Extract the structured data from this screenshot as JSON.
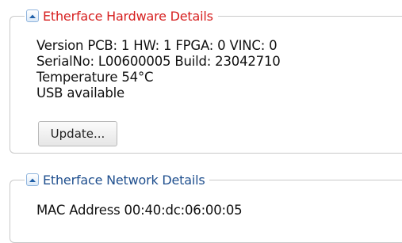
{
  "hardware": {
    "title": "Etherface Hardware Details",
    "lines": [
      "Version PCB: 1 HW: 1 FPGA: 0 VINC: 0",
      "SerialNo: L00600005 Build: 23042710",
      "Temperature 54°C",
      "USB available"
    ],
    "update_label": "Update..."
  },
  "network": {
    "title": "Etherface Network Details",
    "mac_line": "MAC Address 00:40:dc:06:00:05"
  },
  "colors": {
    "hardware_title": "#d61f1f",
    "network_title": "#1f4f8e",
    "group_border": "#c9c9c9"
  }
}
